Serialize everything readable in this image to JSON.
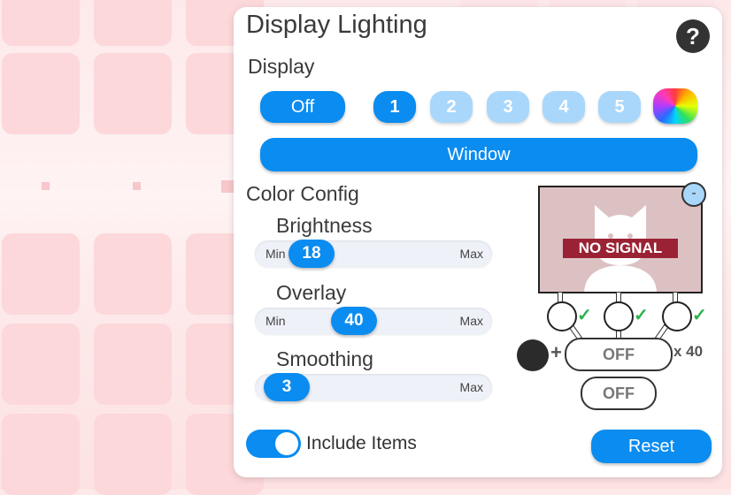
{
  "panel": {
    "title": "Display Lighting",
    "help_label": "?"
  },
  "display": {
    "section_label": "Display",
    "off_label": "Off",
    "buttons": [
      "1",
      "2",
      "3",
      "4",
      "5"
    ],
    "selected": "1",
    "window_label": "Window"
  },
  "color_config": {
    "section_label": "Color Config",
    "brightness": {
      "label": "Brightness",
      "min": "Min",
      "max": "Max",
      "value": "18",
      "fraction": 0.18
    },
    "overlay": {
      "label": "Overlay",
      "min": "Min",
      "max": "Max",
      "value": "40",
      "fraction": 0.4
    },
    "smoothing": {
      "label": "Smoothing",
      "max": "Max",
      "value": "3",
      "fraction": 0.03
    }
  },
  "preview": {
    "no_signal": "NO SIGNAL",
    "minus_label": "-",
    "check": "✓",
    "plus": "+",
    "pill1": "OFF",
    "pill2": "OFF",
    "multiplier": "x 40"
  },
  "footer": {
    "include_items_label": "Include Items",
    "include_items_on": true,
    "reset_label": "Reset"
  },
  "colors": {
    "accent": "#0a8cf0",
    "accent_light": "#a9d7fb",
    "no_signal_bg": "#9b2234",
    "check": "#2bb24c"
  }
}
